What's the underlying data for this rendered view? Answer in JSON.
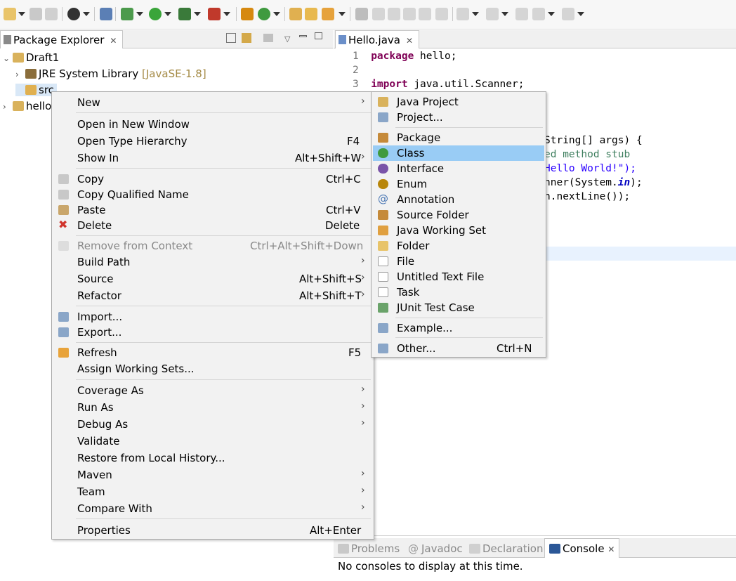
{
  "package_explorer": {
    "tab_label": "Package Explorer",
    "tree": [
      {
        "label": "Draft1",
        "suffix": ""
      },
      {
        "label": "JRE System Library",
        "suffix": "[JavaSE-1.8]"
      },
      {
        "label": "src",
        "suffix": ""
      },
      {
        "label": "hello",
        "suffix": ""
      }
    ]
  },
  "editor": {
    "tab_label": "Hello.java",
    "lines": {
      "n1": "1",
      "n2": "2",
      "n3": "3",
      "l1_kw": "package",
      "l1_rest": " hello;",
      "l3_kw": "import",
      "l3_rest": " java.util.Scanner;",
      "l7": "String[] args) {",
      "l8": "ed method stub",
      "l9": "Hello World!\");",
      "l10_a": "nner(System.",
      "l10_b": "in",
      "l10_c": ");",
      "l11": "n.nextLine());"
    }
  },
  "console": {
    "tabs": [
      "Problems",
      "Javadoc",
      "Declaration",
      "Console"
    ],
    "message": "No consoles to display at this time."
  },
  "context_menu": {
    "items": [
      {
        "label": "New",
        "accel": "",
        "submenu": true
      },
      {
        "label": "Open in New Window",
        "accel": ""
      },
      {
        "label": "Open Type Hierarchy",
        "accel": "F4"
      },
      {
        "label": "Show In",
        "accel": "Alt+Shift+W",
        "submenu": true
      },
      {
        "label": "Copy",
        "accel": "Ctrl+C"
      },
      {
        "label": "Copy Qualified Name",
        "accel": ""
      },
      {
        "label": "Paste",
        "accel": "Ctrl+V"
      },
      {
        "label": "Delete",
        "accel": "Delete"
      },
      {
        "label": "Remove from Context",
        "accel": "Ctrl+Alt+Shift+Down",
        "disabled": true
      },
      {
        "label": "Build Path",
        "accel": "",
        "submenu": true
      },
      {
        "label": "Source",
        "accel": "Alt+Shift+S",
        "submenu": true
      },
      {
        "label": "Refactor",
        "accel": "Alt+Shift+T",
        "submenu": true
      },
      {
        "label": "Import...",
        "accel": ""
      },
      {
        "label": "Export...",
        "accel": ""
      },
      {
        "label": "Refresh",
        "accel": "F5"
      },
      {
        "label": "Assign Working Sets...",
        "accel": ""
      },
      {
        "label": "Coverage As",
        "accel": "",
        "submenu": true
      },
      {
        "label": "Run As",
        "accel": "",
        "submenu": true
      },
      {
        "label": "Debug As",
        "accel": "",
        "submenu": true
      },
      {
        "label": "Validate",
        "accel": ""
      },
      {
        "label": "Restore from Local History...",
        "accel": ""
      },
      {
        "label": "Maven",
        "accel": "",
        "submenu": true
      },
      {
        "label": "Team",
        "accel": "",
        "submenu": true
      },
      {
        "label": "Compare With",
        "accel": "",
        "submenu": true
      },
      {
        "label": "Properties",
        "accel": "Alt+Enter"
      }
    ]
  },
  "new_submenu": {
    "items": [
      {
        "label": "Java Project",
        "accel": ""
      },
      {
        "label": "Project...",
        "accel": ""
      },
      {
        "label": "Package",
        "accel": ""
      },
      {
        "label": "Class",
        "accel": "",
        "highlighted": true
      },
      {
        "label": "Interface",
        "accel": ""
      },
      {
        "label": "Enum",
        "accel": ""
      },
      {
        "label": "Annotation",
        "accel": ""
      },
      {
        "label": "Source Folder",
        "accel": ""
      },
      {
        "label": "Java Working Set",
        "accel": ""
      },
      {
        "label": "Folder",
        "accel": ""
      },
      {
        "label": "File",
        "accel": ""
      },
      {
        "label": "Untitled Text File",
        "accel": ""
      },
      {
        "label": "Task",
        "accel": ""
      },
      {
        "label": "JUnit Test Case",
        "accel": ""
      },
      {
        "label": "Example...",
        "accel": ""
      },
      {
        "label": "Other...",
        "accel": "Ctrl+N"
      }
    ]
  },
  "colors": {
    "highlight": "#99ccf5",
    "keyword": "#7f0055",
    "string": "#2a00ff",
    "comment": "#3f7f5f"
  }
}
